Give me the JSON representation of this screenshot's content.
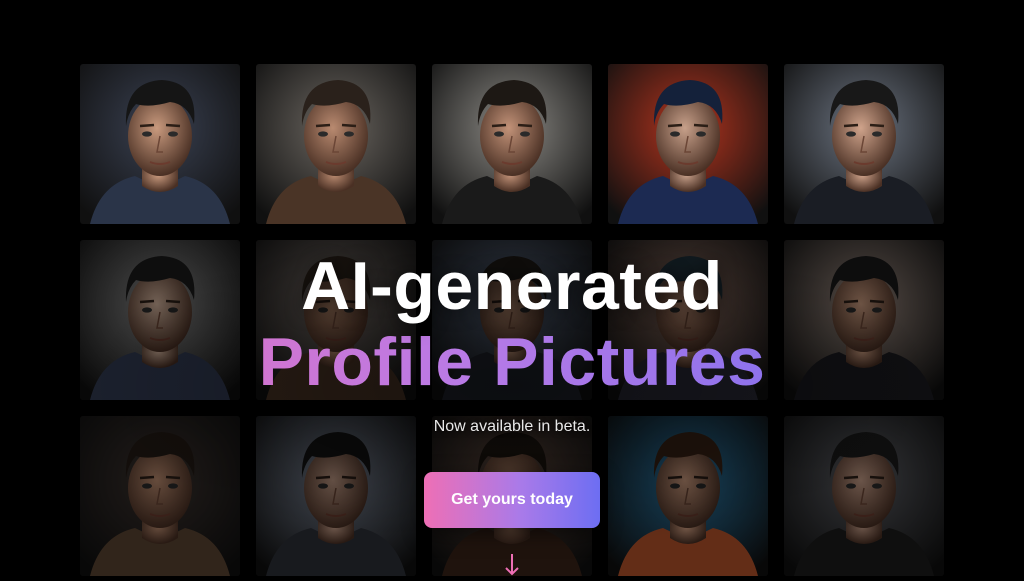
{
  "hero": {
    "title_line1": "AI-generated",
    "title_line2": "Profile Pictures",
    "subtitle": "Now available in beta.",
    "cta_label": "Get yours today"
  },
  "colors": {
    "background": "#000000",
    "gradient_start": "#ee6fb5",
    "gradient_end": "#6a6cf2"
  },
  "portraits": [
    {
      "bg": "#3a4152",
      "skin": "#c99a7e",
      "hair": "#151515",
      "shirt": "#2a3448"
    },
    {
      "bg": "#6b6660",
      "skin": "#b98a70",
      "hair": "#2a211b",
      "shirt": "#4a3426"
    },
    {
      "bg": "#8c8a85",
      "skin": "#c29278",
      "hair": "#1d1814",
      "shirt": "#1a1a1a"
    },
    {
      "bg": "#b3341e",
      "skin": "#c7a08a",
      "hair": "#14213a",
      "shirt": "#1c2a52"
    },
    {
      "bg": "#6b7380",
      "skin": "#cfa38b",
      "hair": "#181818",
      "shirt": "#1a1d24"
    },
    {
      "bg": "#8a8a8a",
      "skin": "#d2b29c",
      "hair": "#1b1b1b",
      "shirt": "#323b52"
    },
    {
      "bg": "#7a706a",
      "skin": "#b8896c",
      "hair": "#2b221b",
      "shirt": "#4a3426"
    },
    {
      "bg": "#5a6880",
      "skin": "#c49578",
      "hair": "#1e1a16",
      "shirt": "#22262e"
    },
    {
      "bg": "#8f6f62",
      "skin": "#c9967a",
      "hair": "#20303a",
      "shirt": "#2a2a38"
    },
    {
      "bg": "#9c8a80",
      "skin": "#c99a7e",
      "hair": "#181818",
      "shirt": "#1b1b1f"
    },
    {
      "bg": "#3d3430",
      "skin": "#b98a6e",
      "hair": "#231b15",
      "shirt": "#5a4432"
    },
    {
      "bg": "#7d8799",
      "skin": "#c8a08a",
      "hair": "#131313",
      "shirt": "#2d3038"
    },
    {
      "bg": "#6a5246",
      "skin": "#b38468",
      "hair": "#1e1612",
      "shirt": "#3a2418"
    },
    {
      "bg": "#2d7fb0",
      "skin": "#d6a284",
      "hair": "#3a2416",
      "shirt": "#b5532b"
    },
    {
      "bg": "#5e6066",
      "skin": "#c39b86",
      "hair": "#1a1a1a",
      "shirt": "#1c1c1c"
    }
  ]
}
